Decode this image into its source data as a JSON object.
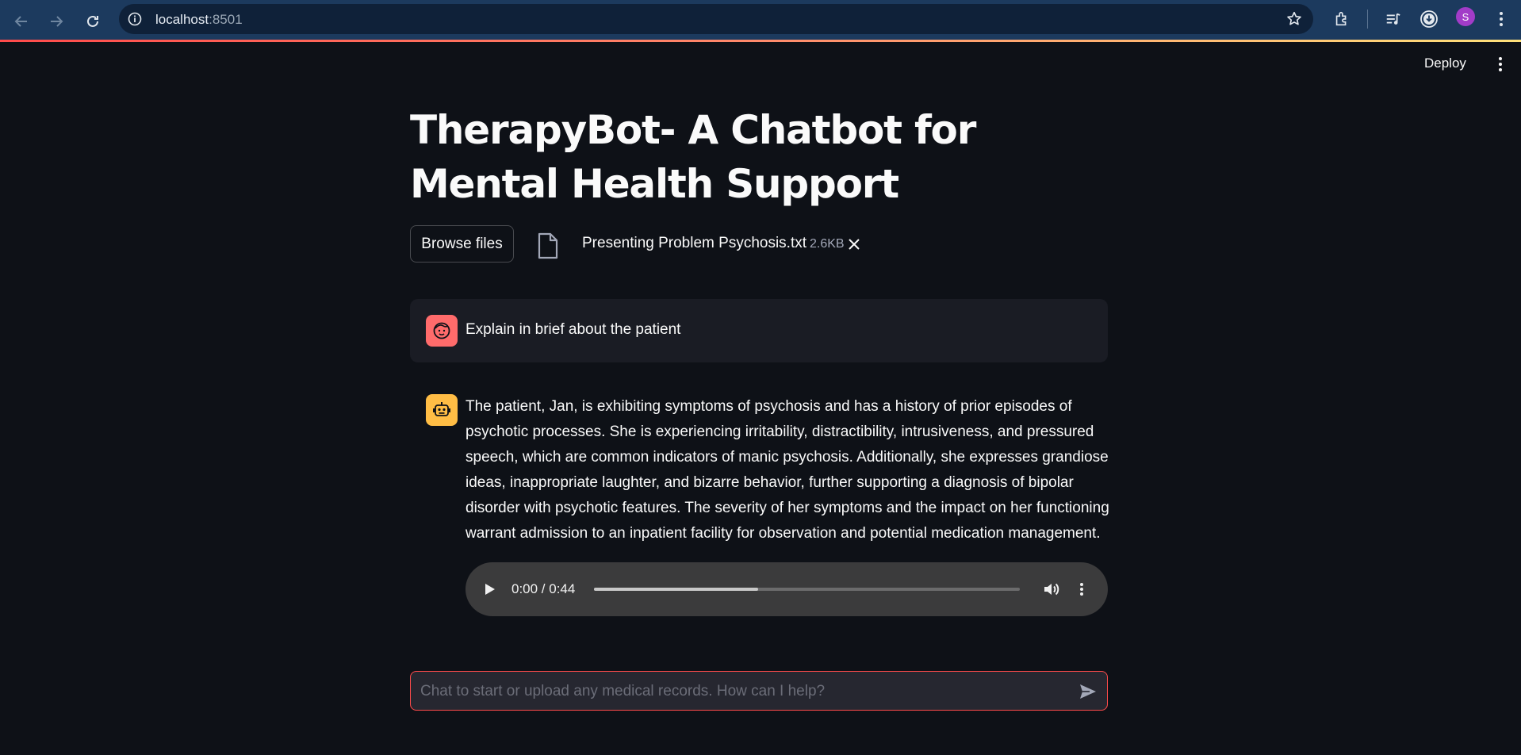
{
  "browser": {
    "url_host": "localhost",
    "url_port": ":8501",
    "profile_initial": "S"
  },
  "header": {
    "deploy_label": "Deploy"
  },
  "page": {
    "title": "TherapyBot- A Chatbot for Mental Health Support"
  },
  "uploader": {
    "browse_label": "Browse files",
    "file_name": "Presenting Problem Psychosis.txt",
    "file_size": "2.6KB"
  },
  "messages": [
    {
      "role": "user",
      "text": "Explain in brief about the patient"
    },
    {
      "role": "assistant",
      "text": "The patient, Jan, is exhibiting symptoms of psychosis and has a history of prior episodes of psychotic processes. She is experiencing irritability, distractibility, intrusiveness, and pressured speech, which are common indicators of manic psychosis. Additionally, she expresses grandiose ideas, inappropriate laughter, and bizarre behavior, further supporting a diagnosis of bipolar disorder with psychotic features. The severity of her symptoms and the impact on her functioning warrant admission to an inpatient facility for observation and potential medication management."
    }
  ],
  "audio": {
    "time_display": "0:00 / 0:44",
    "buffered_fraction": 0.385
  },
  "chat_input": {
    "placeholder": "Chat to start or upload any medical records. How can I help?"
  },
  "colors": {
    "background": "#0e1117",
    "accent": "#ff4b4b",
    "user_avatar": "#ff6b6b",
    "bot_avatar": "#ffbd45"
  },
  "icons": [
    "back-arrow-icon",
    "forward-arrow-icon",
    "reload-icon",
    "site-info-icon",
    "bookmark-star-icon",
    "extensions-icon",
    "media-controls-icon",
    "download-icon",
    "browser-menu-icon",
    "app-menu-icon",
    "file-icon",
    "close-icon",
    "user-face-icon",
    "robot-icon",
    "play-icon",
    "volume-icon",
    "more-options-icon",
    "send-icon"
  ]
}
